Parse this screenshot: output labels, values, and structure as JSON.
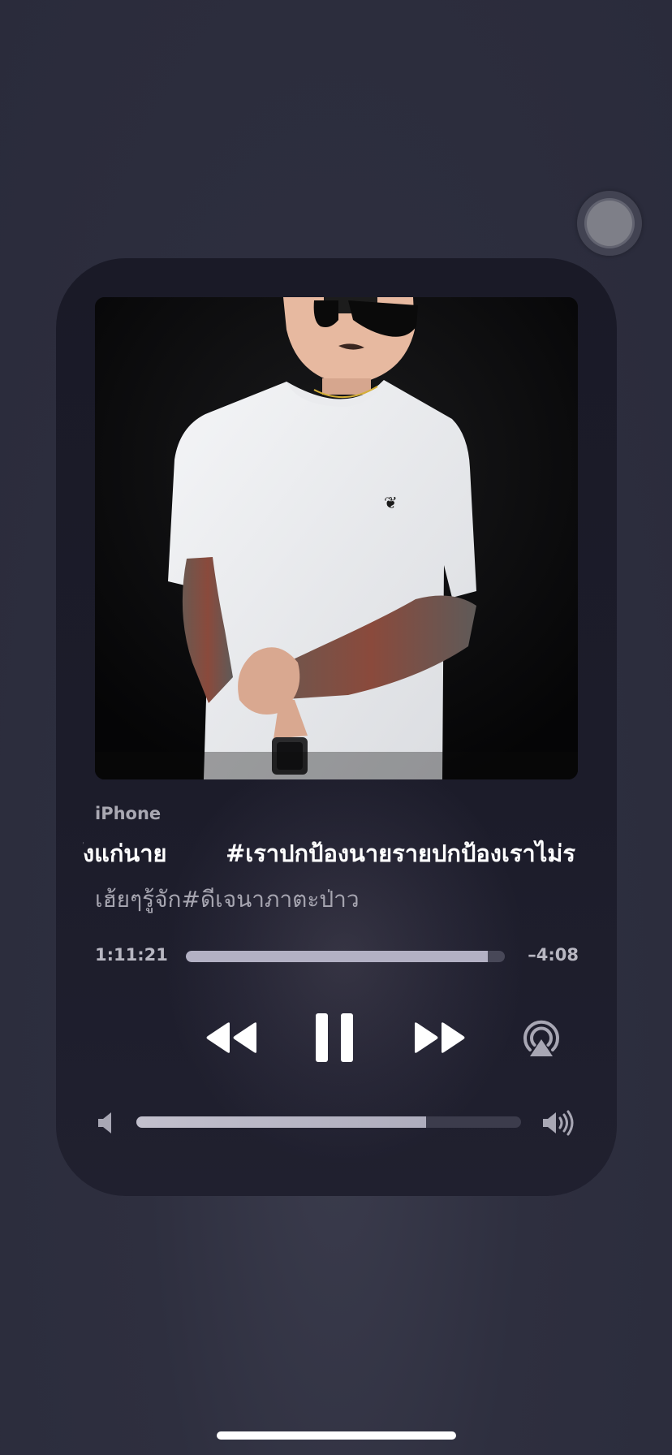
{
  "now_playing": {
    "source": "iPhone",
    "title_part_a": "ังแก่นาย",
    "title_part_b": "#เราปกป้องนายรายปกป้องเราไม่ร",
    "artist": "เฮ้ยๆรู้จัก#ดีเจนาภาตะป่าว",
    "artwork_icon": "album-artwork-photo"
  },
  "playback": {
    "elapsed": "1:11:21",
    "remaining": "–4:08",
    "progress": 0.946
  },
  "controls": {
    "rewind_icon": "rewind-icon",
    "pause_icon": "pause-icon",
    "forward_icon": "fast-forward-icon",
    "airplay_icon": "airplay-icon"
  },
  "volume": {
    "level": 0.753,
    "low_icon": "volume-low-icon",
    "high_icon": "volume-high-icon"
  },
  "colors": {
    "background": "#2c2d3d",
    "card": "#1a1a27",
    "accent_fill": "#b3b1c4",
    "title_text": "#ffffff",
    "secondary_text": "#a6a5b0"
  }
}
